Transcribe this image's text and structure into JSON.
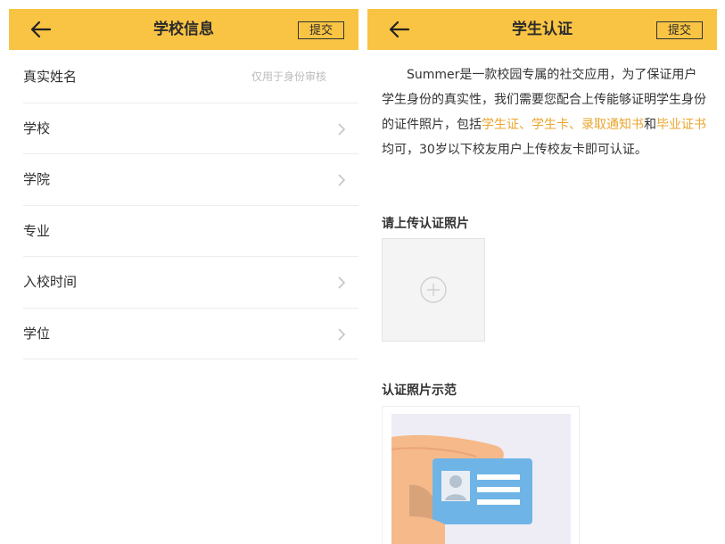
{
  "colors": {
    "accent": "#f9c443",
    "highlight": "#e9a52e"
  },
  "left": {
    "header": {
      "title": "学校信息",
      "submit_label": "提交",
      "back_icon": "back-arrow-icon"
    },
    "fields": [
      {
        "label": "真实姓名",
        "hint": "仅用于身份审核",
        "chevron": false
      },
      {
        "label": "学校",
        "hint": "",
        "chevron": true
      },
      {
        "label": "学院",
        "hint": "",
        "chevron": true
      },
      {
        "label": "专业",
        "hint": "",
        "chevron": false
      },
      {
        "label": "入校时间",
        "hint": "",
        "chevron": true
      },
      {
        "label": "学位",
        "hint": "",
        "chevron": true
      }
    ]
  },
  "right": {
    "header": {
      "title": "学生认证",
      "submit_label": "提交",
      "back_icon": "back-arrow-icon"
    },
    "intro": {
      "part1": "Summer是一款校园专属的社交应用，为了保证用户学生身份的真实性，我们需要您配合上传能够证明学生身份的证件照片，包括",
      "hl1": "学生证、学生卡、录取通知书",
      "part2": "和",
      "hl2": "毕业证书",
      "part3": "均可，30岁以下校友用户上传校友卡即可认证。"
    },
    "upload_title": "请上传认证照片",
    "upload_icon": "add-photo-plus-icon",
    "sample_title": "认证照片示范",
    "sample_icon": "id-card-illustration"
  }
}
